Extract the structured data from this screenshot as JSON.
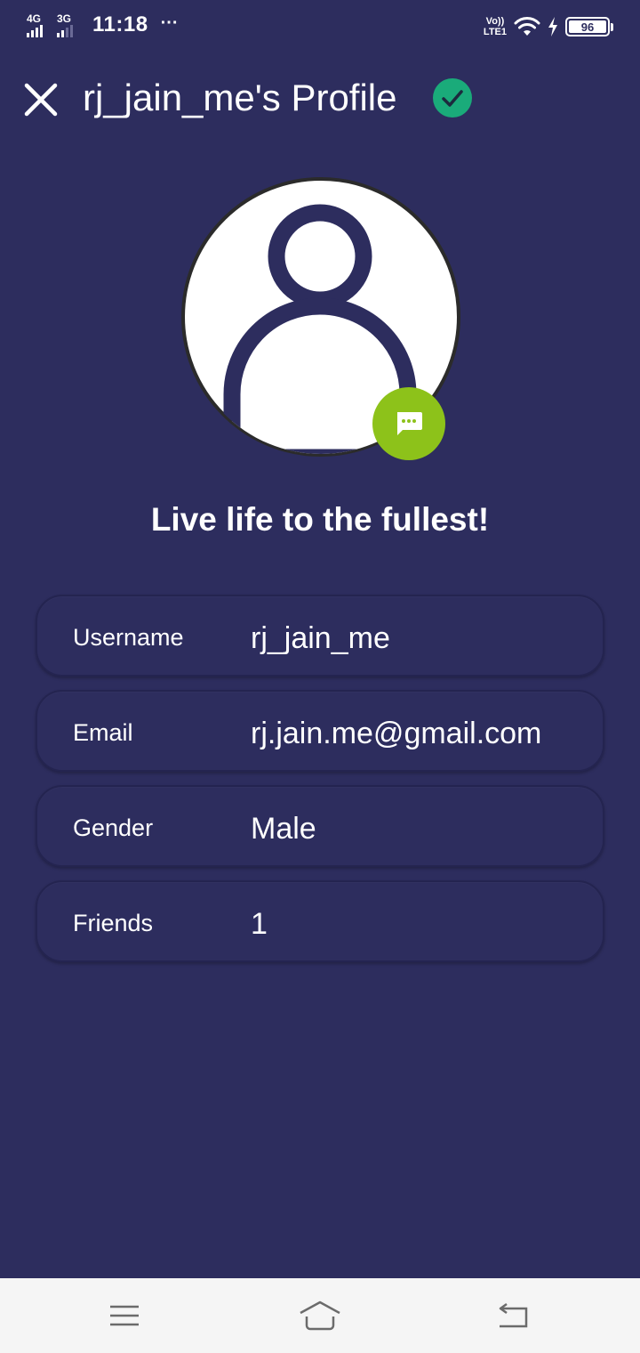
{
  "status_bar": {
    "network1": "4G",
    "network2": "3G",
    "time": "11:18",
    "more": "···",
    "volte_top": "Vo))",
    "volte_bottom": "LTE1",
    "battery": "96"
  },
  "header": {
    "title": "rj_jain_me's Profile"
  },
  "profile": {
    "bio": "Live life to the fullest!"
  },
  "info": [
    {
      "label": "Username",
      "value": "rj_jain_me"
    },
    {
      "label": "Email",
      "value": "rj.jain.me@gmail.com"
    },
    {
      "label": "Gender",
      "value": "Male"
    },
    {
      "label": "Friends",
      "value": "1"
    }
  ],
  "colors": {
    "background": "#2d2d5e",
    "verified": "#1aab7a",
    "chat_badge": "#8dc21a",
    "nav_bar": "#f5f5f5"
  },
  "icons": {
    "close": "close-icon",
    "verified": "check-circle-icon",
    "avatar": "user-avatar-icon",
    "chat": "chat-bubble-icon",
    "menu": "menu-icon",
    "home": "home-icon",
    "back": "back-icon"
  }
}
